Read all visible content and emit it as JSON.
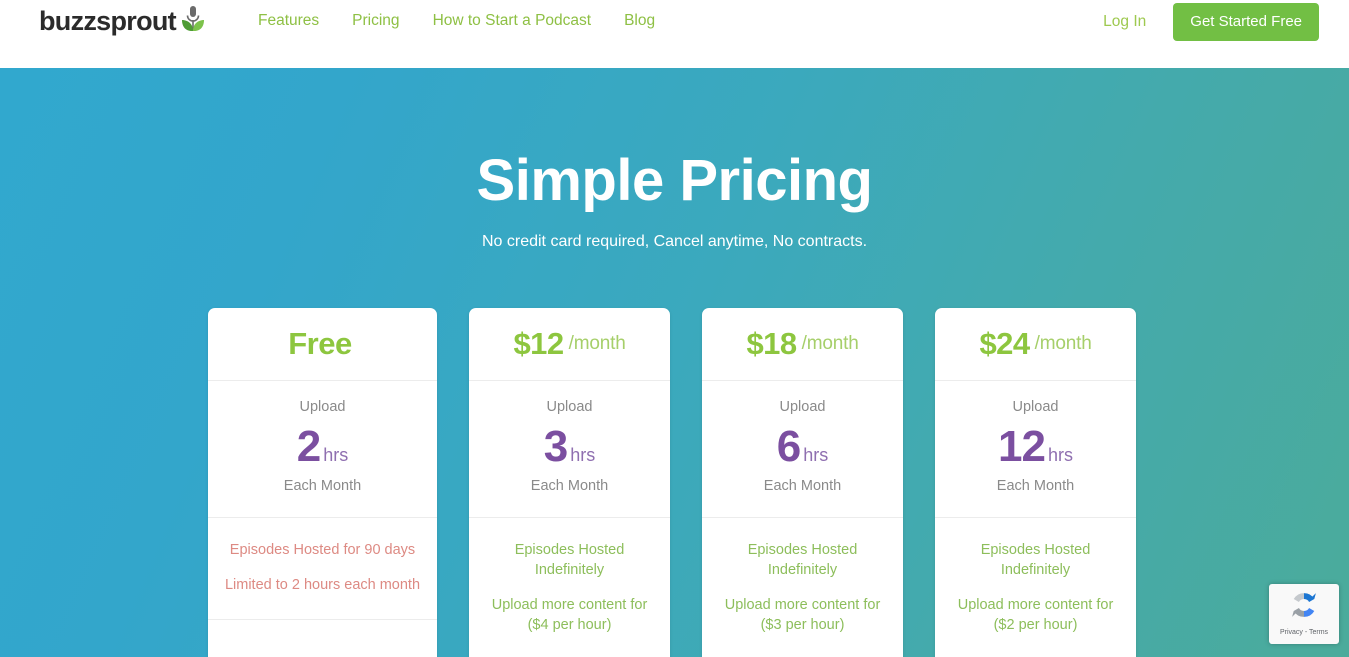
{
  "header": {
    "logo_text": "buzzsprout",
    "logo_icon": "sprout-microphone-icon",
    "nav": [
      {
        "label": "Features"
      },
      {
        "label": "Pricing"
      },
      {
        "label": "How to Start a Podcast"
      },
      {
        "label": "Blog"
      }
    ],
    "login_label": "Log In",
    "cta_label": "Get Started Free",
    "cta_color": "#72bf44",
    "nav_link_color": "#8ec044"
  },
  "hero": {
    "title": "Simple Pricing",
    "subtitle": "No credit card required, Cancel anytime, No contracts.",
    "gradient_start": "#31a8ce",
    "gradient_end": "#4bab9b"
  },
  "pricing": {
    "price_color": "#8dc63f",
    "hours_color": "#7b4fa0",
    "note_green": "#8dbe5b",
    "note_red": "#dd8a83",
    "upload_label": "Upload",
    "each_month_label": "Each Month",
    "plans": [
      {
        "price_amount": "Free",
        "price_per": "",
        "upload_label": "Upload",
        "hours_num": "2",
        "hours_unit": "hrs",
        "each_month_label": "Each Month",
        "note1": "Episodes Hosted for 90 days",
        "note2": "Limited to 2 hours each month",
        "note_tone": "red"
      },
      {
        "price_amount": "$12",
        "price_per": "/month",
        "upload_label": "Upload",
        "hours_num": "3",
        "hours_unit": "hrs",
        "each_month_label": "Each Month",
        "note1": "Episodes Hosted Indefinitely",
        "note2": "Upload more content for ($4 per hour)",
        "note_tone": "green"
      },
      {
        "price_amount": "$18",
        "price_per": "/month",
        "upload_label": "Upload",
        "hours_num": "6",
        "hours_unit": "hrs",
        "each_month_label": "Each Month",
        "note1": "Episodes Hosted Indefinitely",
        "note2": "Upload more content for ($3 per hour)",
        "note_tone": "green"
      },
      {
        "price_amount": "$24",
        "price_per": "/month",
        "upload_label": "Upload",
        "hours_num": "12",
        "hours_unit": "hrs",
        "each_month_label": "Each Month",
        "note1": "Episodes Hosted Indefinitely",
        "note2": "Upload more content for ($2 per hour)",
        "note_tone": "green"
      }
    ]
  },
  "recaptcha": {
    "icon": "recaptcha-icon",
    "terms_text": "Privacy - Terms"
  }
}
